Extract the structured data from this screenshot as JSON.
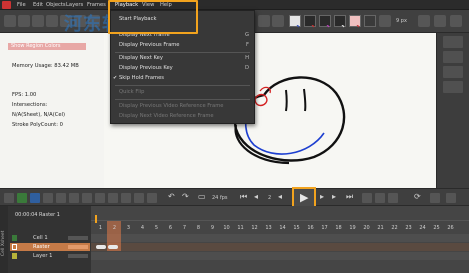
{
  "menubar": {
    "items": [
      "File",
      "Edit",
      "Objects",
      "Layers",
      "Frames",
      "Playback",
      "View",
      "Help"
    ]
  },
  "watermark": "河东软件园",
  "toolbar": {
    "fps_label": "9 px"
  },
  "hud": {
    "highlighted": "Show Region Colors",
    "memory": "Memory Usage: 83.42 MB",
    "fps": "FPS: 1.00",
    "intersections": "Intersections:",
    "intersections_value": "N/A(Sheet), N/A(Cel)",
    "stroke_polycount": "Stroke PolyCount: 0"
  },
  "playback_menu": {
    "items": [
      {
        "label": "Start Playback",
        "shortcut": "",
        "disabled": false,
        "checked": false
      },
      {
        "label": "Display Next Frame",
        "shortcut": "G",
        "disabled": false,
        "checked": false
      },
      {
        "label": "Display Previous Frame",
        "shortcut": "F",
        "disabled": false,
        "checked": false
      },
      {
        "label": "Display Next Key",
        "shortcut": "H",
        "disabled": false,
        "checked": false
      },
      {
        "label": "Display Previous Key",
        "shortcut": "D",
        "disabled": false,
        "checked": false
      },
      {
        "label": "Skip Hold Frames",
        "shortcut": "",
        "disabled": false,
        "checked": true
      },
      {
        "label": "Quick Flip",
        "shortcut": "",
        "disabled": true,
        "checked": false
      },
      {
        "label": "Display Previous Video Reference Frame",
        "shortcut": "",
        "disabled": true,
        "checked": false
      },
      {
        "label": "Display Next Video Reference Frame",
        "shortcut": "",
        "disabled": true,
        "checked": false
      }
    ]
  },
  "playbar": {
    "fps": "24 fps",
    "frame_value": "2",
    "play_label": "Play"
  },
  "timeline": {
    "header": "00:00:04  Raster 1",
    "frame_numbers": [
      "1",
      "2",
      "3",
      "4",
      "5",
      "6",
      "7",
      "8",
      "9",
      "10",
      "11",
      "12",
      "13",
      "14",
      "15",
      "16",
      "17",
      "18",
      "19",
      "20",
      "21",
      "22",
      "23",
      "24",
      "25",
      "26"
    ],
    "layers": [
      {
        "name": "Cell 1",
        "color": "#3a7a3a",
        "selected": false
      },
      {
        "name": "Raster",
        "color": "#c9793f",
        "selected": true
      },
      {
        "name": "Layer 1",
        "color": "#b8b33a",
        "selected": false
      }
    ],
    "side_label": "Cell Xsheet"
  },
  "colors": {
    "accent": "#f2a31e",
    "canvas": "#f7f7f3",
    "selection": "#c57a47"
  }
}
